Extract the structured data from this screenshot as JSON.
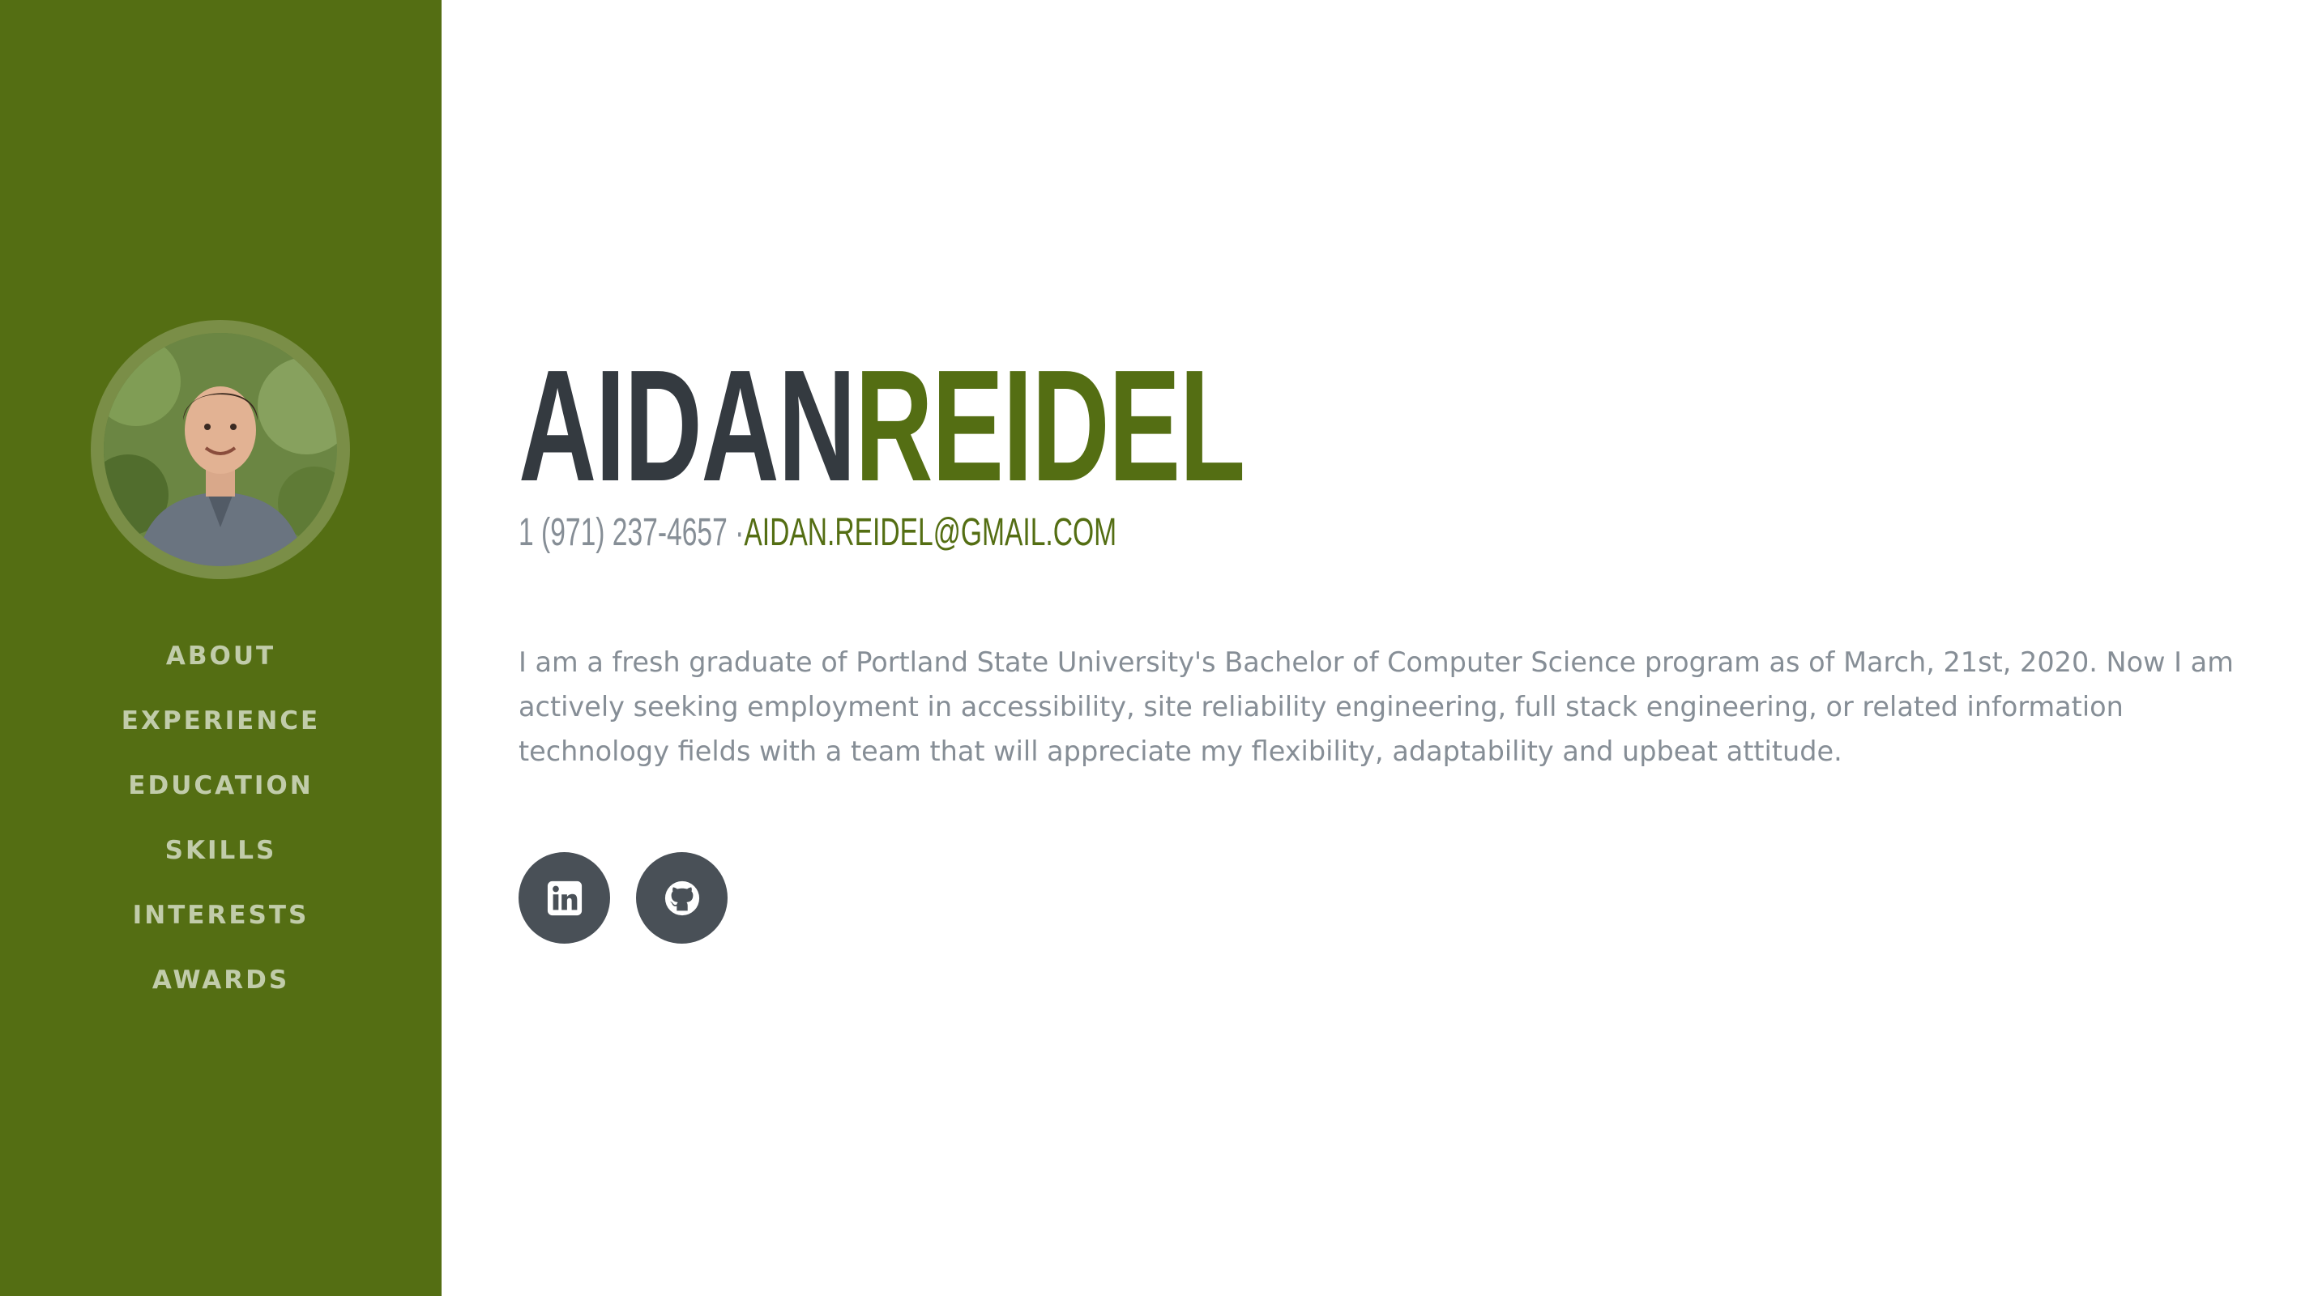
{
  "profile": {
    "photo_alt": "Profile photo",
    "first_name": "AIDAN",
    "last_name": "REIDEL",
    "phone": "1 (971) 237-4657",
    "separator": "·",
    "email": "AIDAN.REIDEL@GMAIL.COM",
    "about": "I am a fresh graduate of Portland State University's Bachelor of Computer Science program as of March, 21st, 2020. Now I am actively seeking employment in accessibility, site reliability engineering, full stack engineering, or related information technology fields with a team that will appreciate my flexibility, adaptability and upbeat attitude."
  },
  "nav": {
    "items": [
      {
        "label": "ABOUT"
      },
      {
        "label": "EXPERIENCE"
      },
      {
        "label": "EDUCATION"
      },
      {
        "label": "SKILLS"
      },
      {
        "label": "INTERESTS"
      },
      {
        "label": "AWARDS"
      }
    ]
  },
  "socials": [
    {
      "icon": "linkedin-icon"
    },
    {
      "icon": "github-icon"
    }
  ],
  "colors": {
    "sidebar": "#546e13",
    "accent": "#546e13",
    "heading_dark": "#343a40",
    "muted_text": "#868e96",
    "nav_text": "#c1ccaa",
    "social_bg": "#495057"
  }
}
